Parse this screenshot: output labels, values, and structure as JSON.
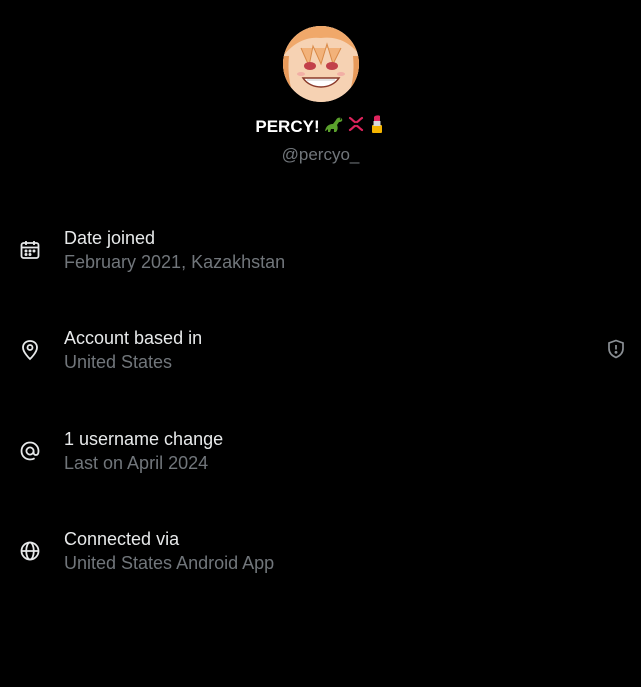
{
  "profile": {
    "display_name": "PERCY!",
    "display_name_emojis": [
      "dinosaur-emoji",
      "anger-emoji",
      "lipstick-emoji"
    ],
    "handle": "@percyo_"
  },
  "details": [
    {
      "icon": "calendar-icon",
      "title": "Date joined",
      "value": "February 2021, Kazakhstan"
    },
    {
      "icon": "location-pin-icon",
      "title": "Account based in",
      "value": "United States",
      "action_icon": "shield-alert-icon"
    },
    {
      "icon": "at-sign-icon",
      "title": "1 username change",
      "value": "Last on April 2024"
    },
    {
      "icon": "globe-icon",
      "title": "Connected via",
      "value": "United States Android App"
    }
  ],
  "colors": {
    "background": "#000000",
    "primary_text": "#e7e9ea",
    "secondary_text": "#71767b"
  }
}
